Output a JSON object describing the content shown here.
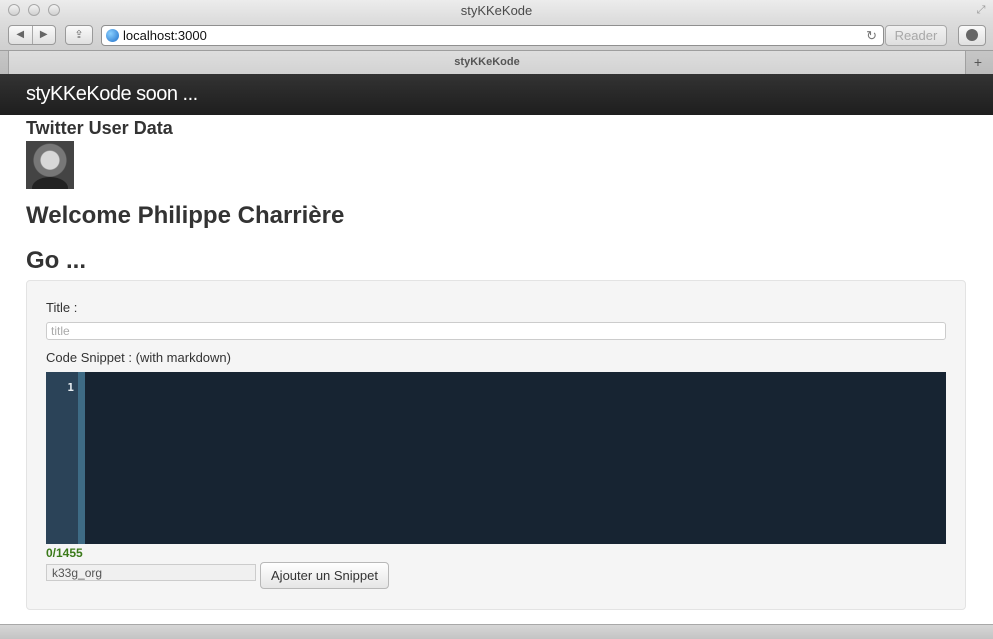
{
  "window": {
    "title": "styKKeKode"
  },
  "toolbar": {
    "back_icon": "◀",
    "forward_icon": "▶",
    "share_icon": "⇪",
    "url": "localhost:3000",
    "reload_icon": "↻",
    "reader_label": "Reader"
  },
  "tabs": [
    {
      "label": "styKKeKode"
    }
  ],
  "newtab_icon": "+",
  "fullscreen_icon": "⤢",
  "navbar": {
    "brand": "styKKeKode soon ..."
  },
  "page": {
    "twitter_heading": "Twitter User Data",
    "welcome_heading": "Welcome Philippe Charrière",
    "go_heading": "Go ..."
  },
  "form": {
    "title_label": "Title :",
    "title_placeholder": "title",
    "code_label": "Code Snippet : (with markdown)",
    "line_number": "1",
    "counter": "0/1455",
    "user_value": "k33g_org",
    "submit_label": "Ajouter un Snippet"
  }
}
